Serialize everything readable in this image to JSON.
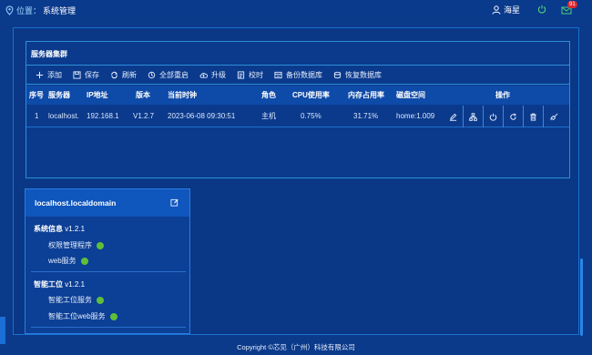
{
  "topbar": {
    "location_label": "位置：",
    "location_value": "系统管理",
    "user_name": "海星",
    "message_count": "91"
  },
  "cluster": {
    "title": "服务器集群",
    "toolbar": [
      {
        "label": "添加",
        "icon": "plus-icon"
      },
      {
        "label": "保存",
        "icon": "save-icon"
      },
      {
        "label": "刷新",
        "icon": "refresh-icon"
      },
      {
        "label": "全部重启",
        "icon": "restart-all-icon"
      },
      {
        "label": "升级",
        "icon": "upgrade-icon"
      },
      {
        "label": "校时",
        "icon": "clock-sync-icon"
      },
      {
        "label": "备份数据库",
        "icon": "backup-db-icon"
      },
      {
        "label": "恢复数据库",
        "icon": "restore-db-icon"
      }
    ],
    "columns": [
      "序号",
      "服务器",
      "IP地址",
      "版本",
      "当前时钟",
      "角色",
      "CPU使用率",
      "内存占用率",
      "磁盘空间",
      "操作"
    ],
    "rows": [
      {
        "index": "1",
        "server": "localhost.",
        "ip": "192.168.1",
        "version": "V1.2.7",
        "clock": "2023-06-08 09:30:51",
        "role": "主机",
        "cpu": "0.75%",
        "mem": "31.71%",
        "disk": "home:1.009"
      }
    ],
    "row_actions": [
      "edit-icon",
      "topology-icon",
      "power-icon",
      "restart-icon",
      "delete-icon",
      "clean-icon"
    ]
  },
  "panel": {
    "title": "localhost.localdomain",
    "groups": [
      {
        "name": "系统信息",
        "version": "v1.2.1",
        "services": [
          "权限管理程序",
          "web服务"
        ]
      },
      {
        "name": "智能工位",
        "version": "v1.2.1",
        "services": [
          "智能工位服务",
          "智能工位web服务"
        ]
      }
    ],
    "status_color": "#5fbf3a"
  },
  "footer": {
    "copyright": "Copyright ©芯见（广州）科技有限公司"
  },
  "colors": {
    "background": "#0b3a8a",
    "header": "#0e4aa8",
    "accent": "#2b8ed8"
  }
}
